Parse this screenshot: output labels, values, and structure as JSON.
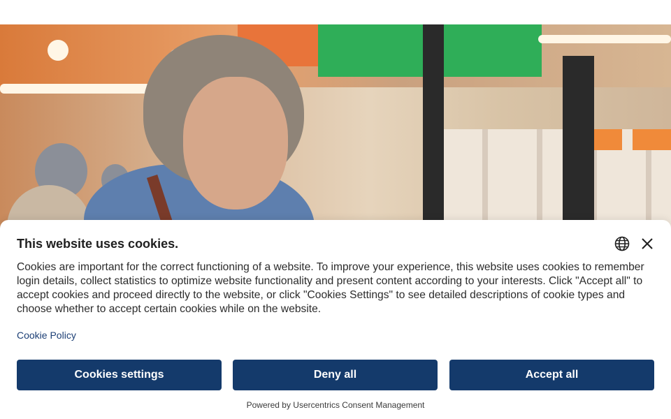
{
  "cookie_banner": {
    "title": "This website uses cookies.",
    "body": "Cookies are important for the correct functioning of a website. To improve your experience, this website uses cookies to remember login details, collect statistics to optimize website functionality and present content according to your interests. Click \"Accept all\" to accept cookies and proceed directly to the website, or click \"Cookies Settings\" to see detailed descriptions of cookie types and choose whether to accept certain cookies while on the website.",
    "policy_link": "Cookie Policy",
    "buttons": {
      "settings": "Cookies settings",
      "deny": "Deny all",
      "accept": "Accept all"
    },
    "powered_by": "Powered by Usercentrics Consent Management",
    "icons": {
      "language": "globe-icon",
      "close": "close-icon"
    }
  },
  "colors": {
    "button_bg": "#143a6b",
    "link": "#1c3f75",
    "title_text": "#1f1f1f"
  }
}
